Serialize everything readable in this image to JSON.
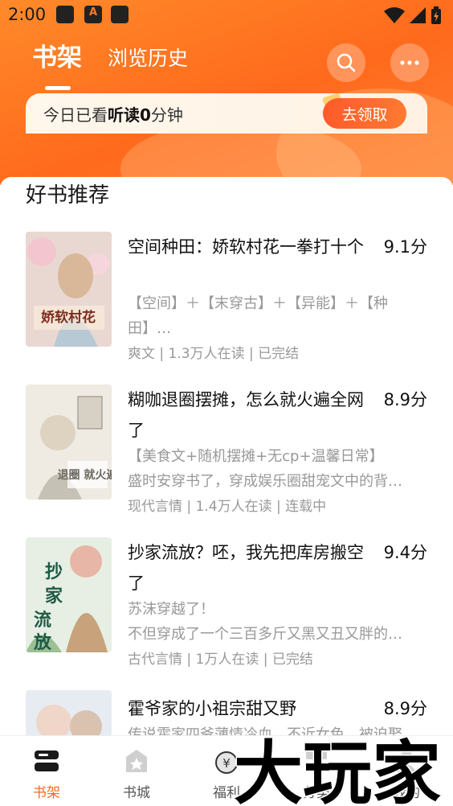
{
  "status_bar": {
    "time": "2:00"
  },
  "header": {
    "tabs": [
      {
        "label": "书架",
        "active": true
      },
      {
        "label": "浏览历史",
        "active": false
      }
    ],
    "icons": [
      "search-icon",
      "more-icon"
    ]
  },
  "reading_card": {
    "prefix": "今日已看",
    "mode": "听读",
    "minutes": "0",
    "suffix": "分钟",
    "claim_button": "去领取"
  },
  "recommend": {
    "title": "好书推荐",
    "books": [
      {
        "title": "空间种田：娇软村花一拳打十个",
        "score": "9.1分",
        "tags": "【空间】＋【末穿古】＋【异能】＋【种田】…",
        "intro": "",
        "meta": "爽文 | 1.3万人在读 | 已完结",
        "cover_text": "娇软村花"
      },
      {
        "title": "糊咖退圈摆摊，怎么就火遍全网了",
        "score": "8.9分",
        "tags": "【美食文+随机摆摊+无cp+温馨日常】",
        "intro": "盛时安穿书了，穿成娱乐圈甜宠文中的背景…",
        "meta": "现代言情 | 1.4万人在读 | 连载中",
        "cover_text": "退圈 就火遍"
      },
      {
        "title": "抄家流放？呸，我先把库房搬空了",
        "score": "9.4分",
        "tags": "苏沫穿越了！",
        "intro": "不但穿成了一个三百多斤又黑又丑又胖的女…",
        "meta": "古代言情 | 1万人在读 | 已完结",
        "cover_text": "抄家流放"
      },
      {
        "title": "霍爷家的小祖宗甜又野",
        "score": "8.9分",
        "tags": "传说霍家四爷薄情冷血，不近女色，被迫娶",
        "intro": "",
        "meta": "",
        "cover_text": ""
      }
    ]
  },
  "bottom_nav": [
    {
      "label": "书架",
      "icon": "bookshelf-icon",
      "active": true
    },
    {
      "label": "书城",
      "icon": "bookstore-icon",
      "active": false
    },
    {
      "label": "福利",
      "icon": "welfare-icon",
      "active": false
    },
    {
      "label": "分类",
      "icon": "category-icon",
      "active": false
    },
    {
      "label": "我的",
      "icon": "profile-icon",
      "active": false
    }
  ],
  "watermark": {
    "text": "大玩家"
  },
  "colors": {
    "accent": "#ff6a1c",
    "header_start": "#ff8a2a",
    "text_gray": "#999999"
  }
}
